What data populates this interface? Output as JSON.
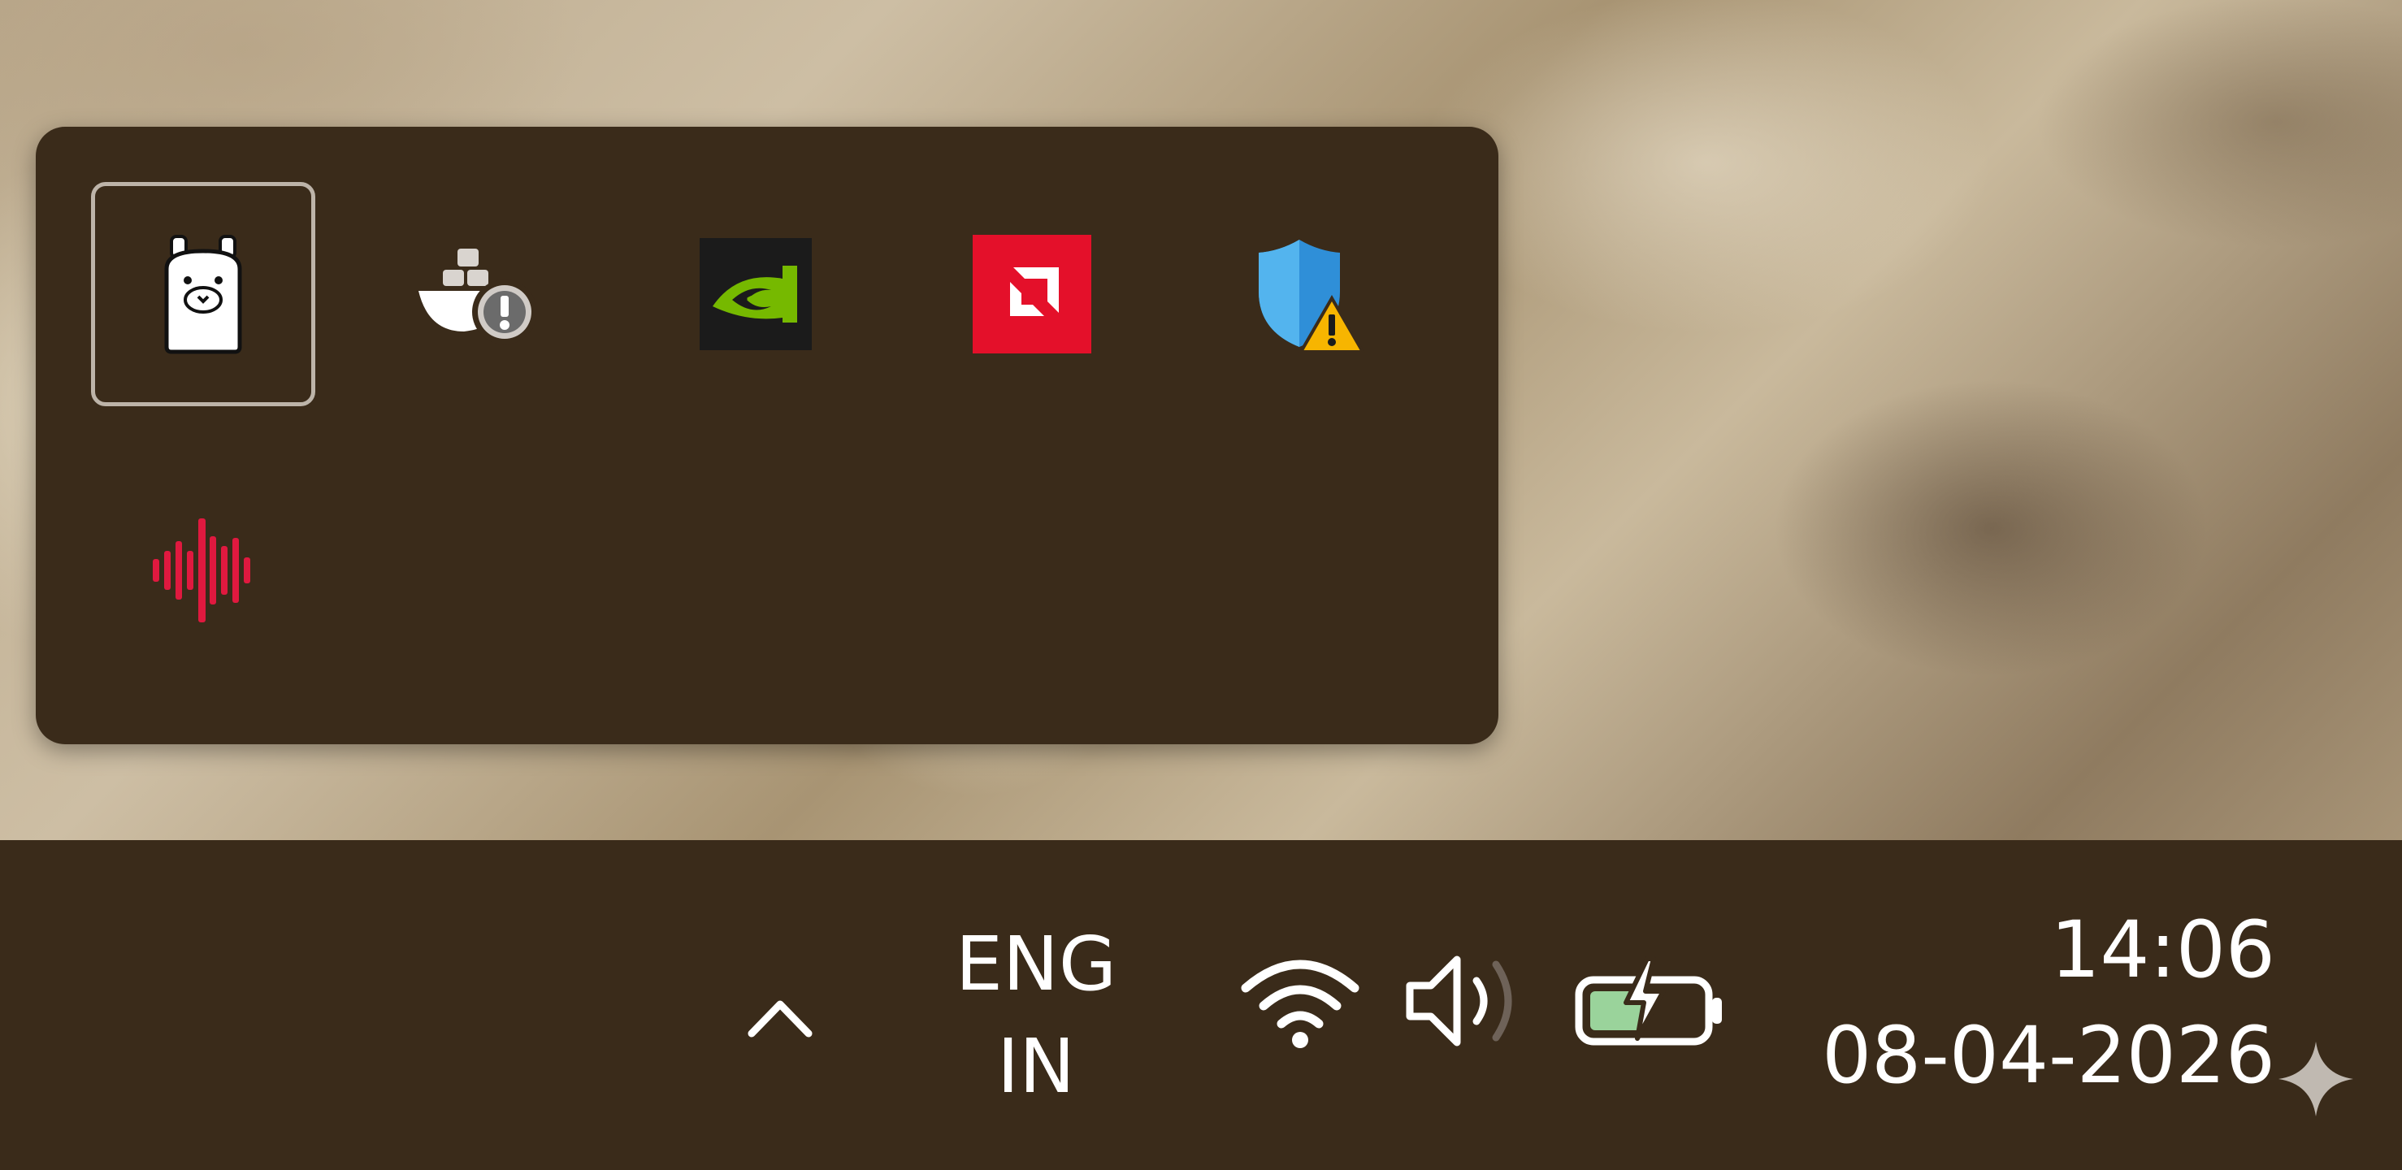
{
  "flyout": {
    "icons": [
      {
        "name": "ollama-icon",
        "selected": true
      },
      {
        "name": "docker-warning-icon",
        "selected": false
      },
      {
        "name": "nvidia-icon",
        "selected": false
      },
      {
        "name": "amd-icon",
        "selected": false
      },
      {
        "name": "security-warning-icon",
        "selected": false
      },
      {
        "name": "audio-waveform-icon",
        "selected": false
      }
    ]
  },
  "taskbar": {
    "chevron_icon": "chevron-up-icon",
    "language": {
      "line1": "ENG",
      "line2": "IN"
    },
    "wifi_icon": "wifi-icon",
    "volume_icon": "volume-icon",
    "battery_icon": "battery-charging-icon",
    "clock": {
      "time": "14:06",
      "date": "08-04-2026"
    }
  },
  "colors": {
    "panel": "#3a2b1a",
    "nvidia_green": "#76b900",
    "amd_red": "#e4102a",
    "shield_blue": "#2f8fd8",
    "warning_yellow": "#f7b500",
    "waveform_red": "#e0193f",
    "battery_green": "#9ad39b"
  }
}
